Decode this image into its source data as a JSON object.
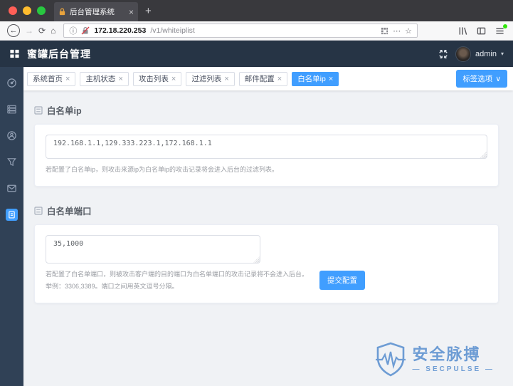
{
  "browser": {
    "tab": {
      "title": "后台管理系统"
    },
    "address": {
      "host": "172.18.220.253",
      "path": "/v1/whiteiplist"
    }
  },
  "glyphs": {
    "close": "×",
    "new_tab": "+",
    "back": "←",
    "forward": "→",
    "reload": "⟳",
    "home": "⌂",
    "info": "ⓘ",
    "ellipsis": "⋯",
    "star": "☆",
    "caret_down": "▾",
    "chevron_down": "∨"
  },
  "header": {
    "title": "蜜罐后台管理",
    "user": "admin"
  },
  "tags_bar": {
    "tabs": [
      {
        "label": "系统首页"
      },
      {
        "label": "主机状态"
      },
      {
        "label": "攻击列表"
      },
      {
        "label": "过滤列表"
      },
      {
        "label": "邮件配置"
      },
      {
        "label": "白名单ip",
        "active": true
      }
    ],
    "options_button": "标签选项"
  },
  "sidebar": {
    "items": [
      {
        "icon": "dashboard-icon"
      },
      {
        "icon": "host-status-icon"
      },
      {
        "icon": "attack-list-icon"
      },
      {
        "icon": "filter-list-icon"
      },
      {
        "icon": "mail-config-icon"
      },
      {
        "icon": "whitelist-icon",
        "active": true
      }
    ]
  },
  "content": {
    "ip_section": {
      "title": "白名单ip",
      "textarea_value": "192.168.1.1,129.333.223.1,172.168.1.1",
      "help": "若配置了白名单ip，则攻击来源ip为白名单ip的攻击记录将会进入后台的过滤列表。"
    },
    "port_section": {
      "title": "白名单端口",
      "textarea_value": "35,1000",
      "help_line1": "若配置了白名单端口，则被攻击客户端的目的端口为白名单端口的攻击记录将不会进入后台。",
      "help_line2": "举例：3306,3389。端口之间用英文逗号分隔。",
      "submit_label": "提交配置"
    }
  },
  "watermark": {
    "title_cn": "安全脉搏",
    "title_en": "— SECPULSE —"
  },
  "colors": {
    "accent": "#409eff",
    "header_bg": "#263445",
    "sidebar_bg": "#304156",
    "content_bg": "#f0f2f5",
    "watermark_blue": "#6d9cd4",
    "favicon_orange": "#e8a33d",
    "update_badge_green": "#30e60b"
  }
}
